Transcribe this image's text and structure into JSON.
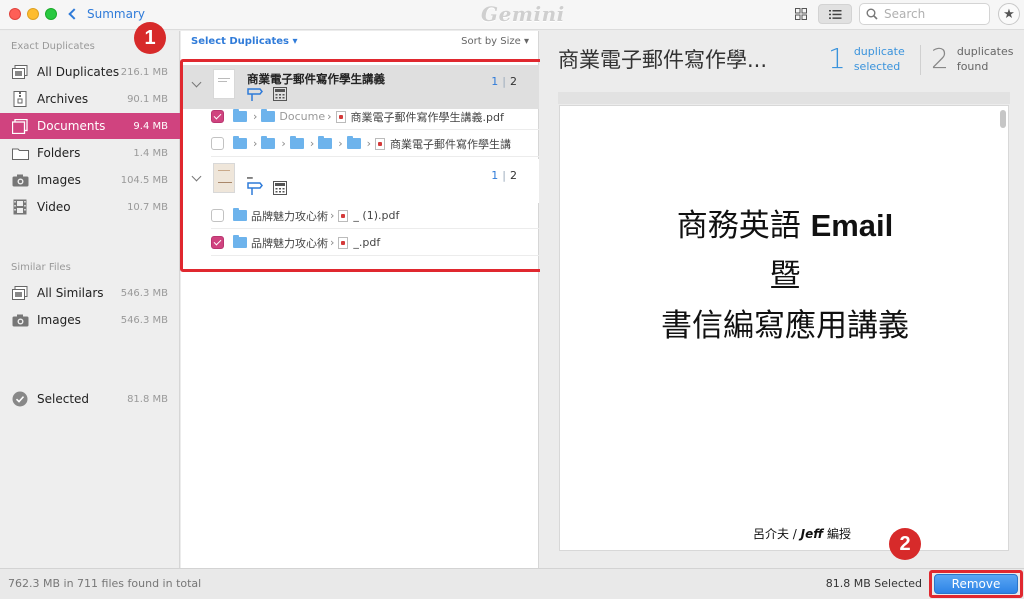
{
  "titlebar": {
    "back_label": "Summary",
    "app_logo": "Gemini",
    "search": {
      "placeholder": "Search"
    }
  },
  "sidebar": {
    "exact_header": "Exact Duplicates",
    "exact_items": [
      {
        "label": "All Duplicates",
        "size": "216.1 MB",
        "icon": "all-duplicates-icon"
      },
      {
        "label": "Archives",
        "size": "90.1 MB",
        "icon": "archive-icon"
      },
      {
        "label": "Documents",
        "size": "9.4 MB",
        "icon": "document-icon"
      },
      {
        "label": "Folders",
        "size": "1.4 MB",
        "icon": "folder-icon"
      },
      {
        "label": "Images",
        "size": "104.5 MB",
        "icon": "camera-icon"
      },
      {
        "label": "Video",
        "size": "10.7 MB",
        "icon": "film-icon"
      }
    ],
    "similar_header": "Similar Files",
    "similar_items": [
      {
        "label": "All Similars",
        "size": "546.3 MB",
        "icon": "all-similars-icon"
      },
      {
        "label": "Images",
        "size": "546.3 MB",
        "icon": "camera-icon"
      }
    ],
    "selected_item": {
      "label": "Selected",
      "size": "81.8 MB",
      "icon": "check-circle-icon"
    }
  },
  "list": {
    "select_duplicates": "Select Duplicates ▾",
    "sort_by": "Sort by Size ▾",
    "groups": [
      {
        "title": "商業電子郵件寫作學生講義",
        "selected": "1",
        "total": "2",
        "files": [
          {
            "checked": true,
            "path_start": "Docume",
            "filename": "商業電子郵件寫作學生講義.pdf"
          },
          {
            "checked": false,
            "filename": "商業電子郵件寫作學生講"
          }
        ]
      },
      {
        "title": "_",
        "selected": "1",
        "total": "2",
        "files": [
          {
            "checked": false,
            "folder": "品牌魅力攻心術",
            "filename": "_ (1).pdf"
          },
          {
            "checked": true,
            "folder": "品牌魅力攻心術",
            "filename": "_.pdf"
          }
        ]
      }
    ]
  },
  "preview": {
    "title": "商業電子郵件寫作學...",
    "stat_selected_num": "1",
    "stat_selected_label1": "duplicate",
    "stat_selected_label2": "selected",
    "stat_found_num": "2",
    "stat_found_label1": "duplicates",
    "stat_found_label2": "found",
    "page": {
      "line1_cjk": "商務英語 ",
      "line1_en": "Email",
      "line2": "暨",
      "line3": "書信編寫應用講義",
      "author_name": "呂介夫",
      "author_sep": " / ",
      "author_en": "Jeff",
      "author_role": " 編授"
    }
  },
  "annotations": {
    "badge1": "1",
    "badge2": "2"
  },
  "bottom": {
    "total_text": "762.3 MB in 711 files found in total",
    "selected_text": "81.8 MB Selected",
    "remove_label": "Remove"
  },
  "colors": {
    "accent_pink": "#d0437f",
    "accent_blue": "#2f7bd9",
    "annotation_red": "#e0282f",
    "remove_blue": "#2d83e6"
  }
}
